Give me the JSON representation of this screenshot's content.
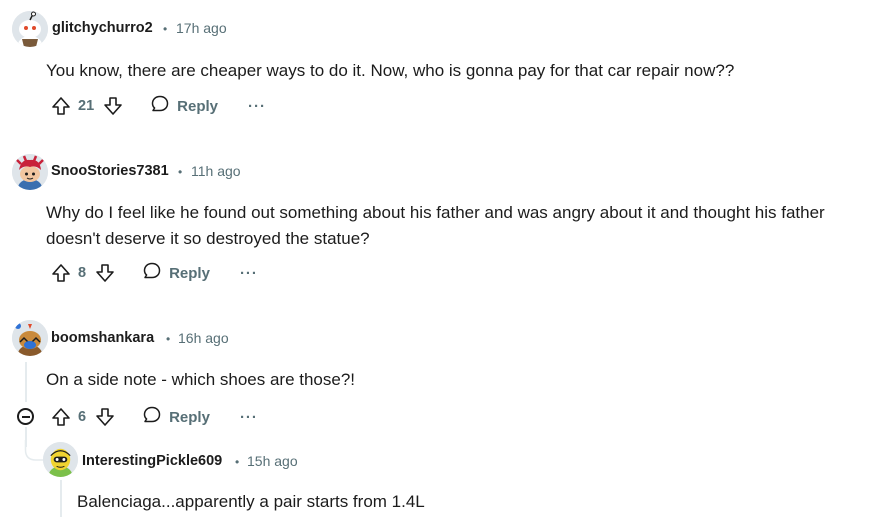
{
  "comments": [
    {
      "username": "glitchychurro2",
      "separator": "•",
      "time": "17h ago",
      "text": "You know, there are cheaper ways to do it. Now, who is gonna pay for that car repair now??",
      "votes": "21",
      "reply_label": "Reply",
      "more_label": "···"
    },
    {
      "username": "SnooStories7381",
      "separator": "•",
      "time": "11h ago",
      "text": "Why do I feel like he found out something about his father and was angry about it and thought his father doesn't deserve it so destroyed the statue?",
      "votes": "8",
      "reply_label": "Reply",
      "more_label": "···"
    },
    {
      "username": "boomshankara",
      "separator": "•",
      "time": "16h ago",
      "text": "On a side note - which shoes are those?!",
      "votes": "6",
      "reply_label": "Reply",
      "more_label": "···"
    },
    {
      "username": "InterestingPickle609",
      "separator": "•",
      "time": "15h ago",
      "text": "Balenciaga...apparently a pair starts from 1.4L"
    }
  ],
  "icons": {
    "upvote": "upvote-arrow-icon",
    "downvote": "downvote-arrow-icon",
    "reply": "speech-bubble-icon",
    "more": "ellipsis-icon",
    "collapse": "collapse-minus-icon"
  },
  "colors": {
    "meta": "#576f76",
    "text": "#1c1c1c",
    "thread_line": "#e5ebee"
  }
}
